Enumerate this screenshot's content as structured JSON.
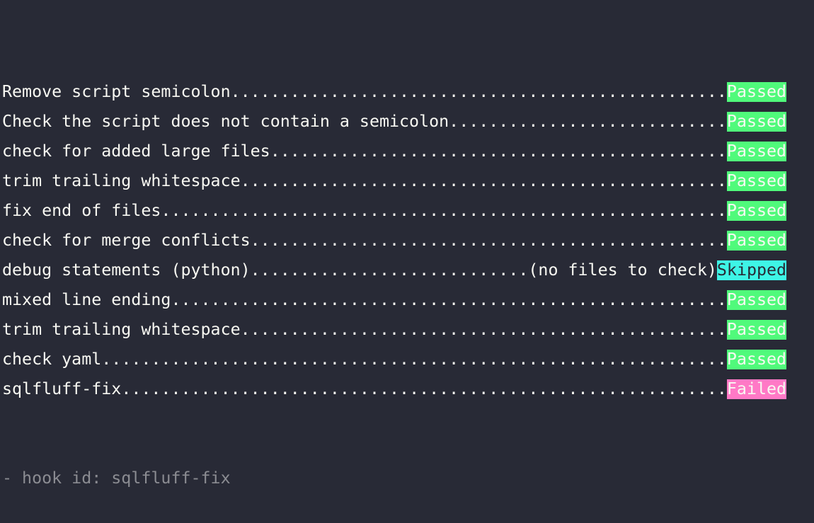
{
  "terminal": {
    "line_width_cols": 79,
    "colors": {
      "background": "#282a36",
      "text": "#f8f8f2",
      "passed": "#50fa7b",
      "skipped": "#3ef5e6",
      "failed": "#ff79c6",
      "muted": "#8b8c92"
    },
    "hooks": [
      {
        "name": "Remove script semicolon",
        "note": "",
        "status": "Passed"
      },
      {
        "name": "Check the script does not contain a semicolon",
        "note": "",
        "status": "Passed"
      },
      {
        "name": "check for added large files",
        "note": "",
        "status": "Passed"
      },
      {
        "name": "trim trailing whitespace",
        "note": "",
        "status": "Passed"
      },
      {
        "name": "fix end of files",
        "note": "",
        "status": "Passed"
      },
      {
        "name": "check for merge conflicts",
        "note": "",
        "status": "Passed"
      },
      {
        "name": "debug statements (python)",
        "note": "(no files to check)",
        "status": "Skipped"
      },
      {
        "name": "mixed line ending",
        "note": "",
        "status": "Passed"
      },
      {
        "name": "trim trailing whitespace",
        "note": "",
        "status": "Passed"
      },
      {
        "name": "check yaml",
        "note": "",
        "status": "Passed"
      },
      {
        "name": "sqlfluff-fix",
        "note": "",
        "status": "Failed"
      }
    ],
    "hook_id_line": "- hook id: sqlfluff-fix"
  }
}
